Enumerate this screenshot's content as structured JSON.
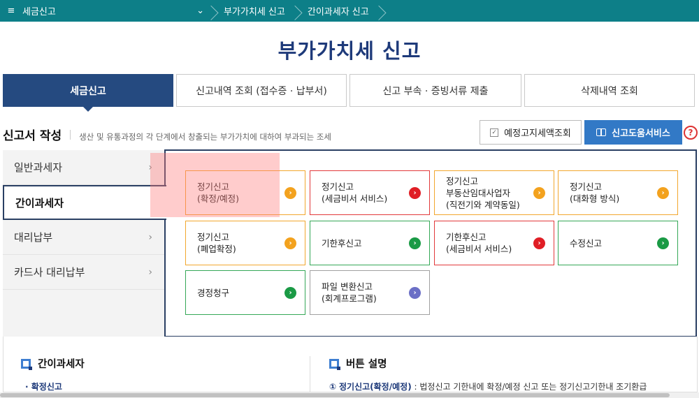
{
  "topbar": {
    "menu_icon": "menu-icon",
    "home": "세금신고",
    "crumbs": [
      "부가가치세 신고",
      "간이과세자 신고"
    ]
  },
  "title": "부가가치세 신고",
  "tabs": [
    {
      "label": "세금신고",
      "active": true
    },
    {
      "label": "신고내역 조회 (접수증 · 납부서)",
      "active": false
    },
    {
      "label": "신고 부속 · 증빙서류 제출",
      "active": false
    },
    {
      "label": "삭제내역 조회",
      "active": false
    }
  ],
  "section": {
    "heading": "신고서 작성",
    "description": "생산 및 유통과정의 각 단계에서 창출되는 부가가치에 대하여 부과되는 조세"
  },
  "buttons": {
    "estimate": "예정고지세액조회",
    "help": "신고도움서비스",
    "help_q": "?"
  },
  "side": [
    {
      "label": "일반과세자",
      "active": false
    },
    {
      "label": "간이과세자",
      "active": true
    },
    {
      "label": "대리납부",
      "active": false
    },
    {
      "label": "카드사 대리납부",
      "active": false
    }
  ],
  "cards": [
    {
      "label": "정기신고\n(확정/예정)",
      "color": "orange"
    },
    {
      "label": "정기신고\n(세금비서 서비스)",
      "color": "red"
    },
    {
      "label": "정기신고\n부동산임대사업자\n(직전기와 계약동일)",
      "color": "orange"
    },
    {
      "label": "정기신고\n(대화형 방식)",
      "color": "orange"
    },
    {
      "label": "정기신고\n(폐업확정)",
      "color": "orange"
    },
    {
      "label": "기한후신고",
      "color": "green"
    },
    {
      "label": "기한후신고\n(세금비서 서비스)",
      "color": "red"
    },
    {
      "label": "수정신고",
      "color": "green"
    },
    {
      "label": "경정청구",
      "color": "green"
    },
    {
      "label": "파일 변환신고\n(회계프로그램)",
      "color": "gray"
    }
  ],
  "info": {
    "left_title": "간이과세자",
    "left_sub": "· 확정신고",
    "right_title": "버튼 설명",
    "right_num": "①",
    "right_key": "정기신고(확정/예정)",
    "right_text": " : 법정신고 기한내에 확정/예정 신고 또는 정기신고기한내 조기환급"
  },
  "colors": {
    "teal": "#0d7f88",
    "navy": "#254a80",
    "title": "#1e3a7a",
    "orange": "#f3a21e",
    "red": "#e01e25",
    "green": "#1a9a45",
    "purple": "#6b6fc6",
    "help_blue": "#3279c6"
  }
}
